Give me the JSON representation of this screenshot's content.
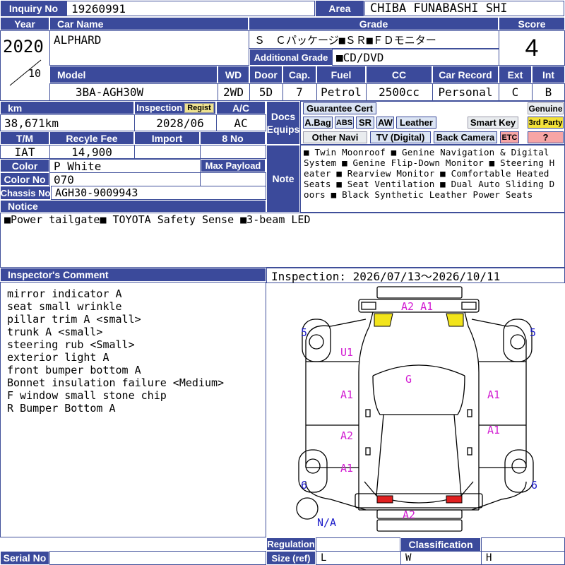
{
  "inquiry": {
    "label": "Inquiry No",
    "value": "19260991"
  },
  "area": {
    "label": "Area",
    "value": "CHIBA FUNABASHI SHI"
  },
  "year": {
    "label": "Year",
    "value": "2020",
    "month": "10"
  },
  "car_name": {
    "label": "Car Name",
    "value": "ALPHARD"
  },
  "grade": {
    "label": "Grade",
    "value": "Ｓ　Ｃパッケージ■ＳＲ■ＦＤモニター",
    "additional_label": "Additional Grade",
    "additional_value": "■CD/DVD"
  },
  "score": {
    "label": "Score",
    "value": "4"
  },
  "specs": {
    "model_label": "Model",
    "model": "3BA-AGH30W",
    "wd_label": "WD",
    "wd": "2WD",
    "door_label": "Door",
    "door": "5D",
    "cap_label": "Cap.",
    "cap": "7",
    "fuel_label": "Fuel",
    "fuel": "Petrol",
    "cc_label": "CC",
    "cc": "2500cc",
    "record_label": "Car Record",
    "record": "Personal",
    "ext_label": "Ext",
    "ext": "C",
    "int_label": "Int",
    "int": "B"
  },
  "details": {
    "km_label": "km",
    "km": "38,671km",
    "inspection_label": "Inspection",
    "regist_label": "Regist",
    "inspection": "2028/06",
    "ac_label": "A/C",
    "ac": "AC",
    "tm_label": "T/M",
    "tm": "IAT",
    "recycle_label": "Recyle Fee",
    "recycle": "14,900",
    "import_label": "Import",
    "import": "",
    "eight_no_label": "8 No",
    "eight_no": "",
    "color_label": "Color",
    "color": "P White",
    "payload_label": "Max Payload",
    "payload": "",
    "color_no_label": "Color No",
    "color_no": "070",
    "chassis_label": "Chassis No",
    "chassis": "AGH30-9009943"
  },
  "docs": {
    "label_line1": "Docs",
    "label_line2": "Equips",
    "guarantee": "Guarantee Cert",
    "abag": "A.Bag",
    "abs": "ABS",
    "sr": "SR",
    "aw": "AW",
    "leather": "Leather",
    "smart_key": "Smart Key",
    "genuine": "Genuine",
    "third_party": "3rd Party",
    "unknown": "?",
    "other_navi": "Other Navi",
    "tv": "TV (Digital)",
    "back_camera": "Back Camera",
    "etc": "ETC"
  },
  "note": {
    "label": "Note",
    "text": "■ Twin Moonroof ■ Genine Navigation & Digital System ■ Genine Flip-Down Monitor ■ Steering Heater ■ Rearview Monitor ■ Comfortable Heated Seats ■ Seat Ventilation ■ Dual Auto Sliding Doors ■ Black Synthetic Leather Power Seats"
  },
  "notice": {
    "label": "Notice",
    "text": "■Power tailgate■ TOYOTA Safety Sense ■3-beam LED"
  },
  "inspector": {
    "label": "Inspector's Comment",
    "lines": [
      "mirror indicator A",
      "seat small wrinkle",
      "pillar trim A <small>",
      "trunk A <small>",
      "steering rub <Small>",
      "exterior light A",
      "front bumper bottom A",
      "Bonnet insulation failure <Medium>",
      "F window small stone chip",
      "R Bumper Bottom A"
    ]
  },
  "inspection_period": "Inspection: 2026/07/13～2026/10/11",
  "diagram": {
    "front_marks": "A2  A1",
    "left_top_tire": "5",
    "right_top_tire": "5",
    "left_front_panel": "U1",
    "hood_or_roof": "G",
    "left_door_front": "A1",
    "right_door_front": "A1",
    "left_door_rear": "A2",
    "right_door_rear": "A1",
    "left_rear_panel": "A1",
    "left_rear_tire": "6",
    "right_rear_tire": "6",
    "rear_mark": "A2",
    "spare": "N/A"
  },
  "bottom": {
    "serial_label": "Serial No",
    "serial": "",
    "regulation_label": "Regulation",
    "size_label": "Size (ref)",
    "classification_label": "Classification",
    "l": "L",
    "w": "W",
    "h": "H"
  }
}
